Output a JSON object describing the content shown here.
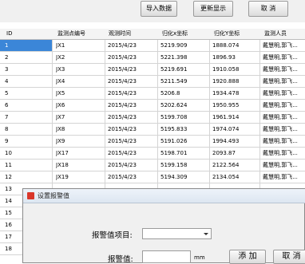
{
  "toolbar": {
    "import_label": "导入数据",
    "refresh_label": "更新显示",
    "cancel_label": "取 消"
  },
  "table": {
    "columns": [
      "ID",
      "监测点编号",
      "观测时间",
      "归化x坐标",
      "归化Y坐标",
      "监测人员"
    ],
    "rows": [
      [
        "1",
        "JX1",
        "2015/4/23",
        "5219.909",
        "1888.074",
        "戴慧明,郭飞..."
      ],
      [
        "2",
        "JX2",
        "2015/4/23",
        "5221.398",
        "1896.93",
        "戴慧明,郭飞..."
      ],
      [
        "3",
        "JX3",
        "2015/4/23",
        "5219.691",
        "1910.058",
        "戴慧明,郭飞..."
      ],
      [
        "4",
        "JX4",
        "2015/4/23",
        "5211.549",
        "1920.888",
        "戴慧明,郭飞..."
      ],
      [
        "5",
        "JX5",
        "2015/4/23",
        "5206.8",
        "1934.478",
        "戴慧明,郭飞..."
      ],
      [
        "6",
        "JX6",
        "2015/4/23",
        "5202.624",
        "1950.955",
        "戴慧明,郭飞..."
      ],
      [
        "7",
        "JX7",
        "2015/4/23",
        "5199.708",
        "1961.914",
        "戴慧明,郭飞..."
      ],
      [
        "8",
        "JX8",
        "2015/4/23",
        "5195.833",
        "1974.074",
        "戴慧明,郭飞..."
      ],
      [
        "9",
        "JX9",
        "2015/4/23",
        "5191.026",
        "1994.493",
        "戴慧明,郭飞..."
      ],
      [
        "10",
        "JX17",
        "2015/4/23",
        "5198.701",
        "2093.87",
        "戴慧明,郭飞..."
      ],
      [
        "11",
        "JX18",
        "2015/4/23",
        "5199.158",
        "2122.564",
        "戴慧明,郭飞..."
      ],
      [
        "12",
        "JX19",
        "2015/4/23",
        "5194.309",
        "2134.054",
        "戴慧明,郭飞..."
      ]
    ],
    "extra_row_ids": [
      "13",
      "14",
      "15",
      "16",
      "17",
      "18"
    ]
  },
  "dialog": {
    "title": "设置报警值",
    "item_label": "报警值项目:",
    "item_value": "",
    "value_label": "报警值:",
    "value_input": "",
    "unit": "mm",
    "add_label": "添 加",
    "cancel_label": "取 消"
  }
}
